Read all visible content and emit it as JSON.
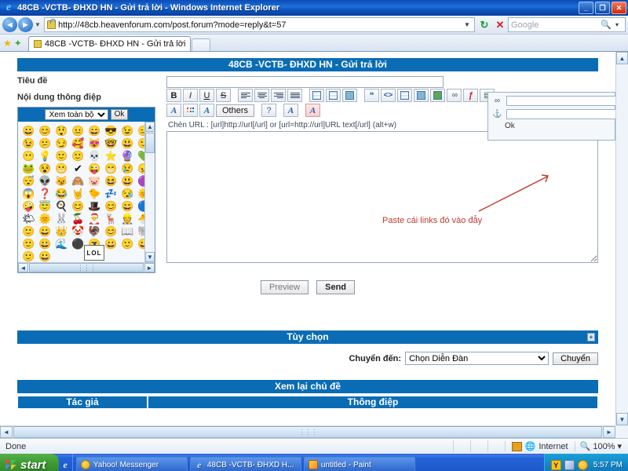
{
  "window": {
    "title": "48CB -VCTB- ĐHXD HN - Gửi trả lời - Windows Internet Explorer",
    "minimize_label": "_",
    "restore_label": "❐",
    "close_label": "✕"
  },
  "browser": {
    "back_label": "◄",
    "forward_label": "►",
    "nav_caret": "▼",
    "url": "http://48cb.heavenforum.com/post.forum?mode=reply&t=57",
    "url_caret": "▼",
    "refresh_label": "↻",
    "stop_label": "✕",
    "search_placeholder": "Google",
    "search_value": "",
    "search_icon": "🔍",
    "search_caret": "▾",
    "tab_title": "48CB -VCTB- ĐHXD HN - Gửi trả lời",
    "favorites_star": "★",
    "add_favorites_star": "✦"
  },
  "forum": {
    "header_title": "48CB -VCTB- ĐHXD HN - Gửi trả lời",
    "subject_label": "Tiêu đề",
    "subject_value": "",
    "message_label": "Nội dung thông điệp",
    "message_value": "",
    "url_hint": "Chèn URL : [url]http://url[/url] or [url=http://url]URL text[/url] (alt+w)",
    "preview_label": "Preview",
    "send_label": "Send",
    "options_title": "Tùy chọn",
    "options_toggle": "+",
    "jump_label": "Chuyển đến:",
    "jump_selected": "Chọn Diễn Đàn",
    "jump_button": "Chuyển",
    "review_title": "Xem lại chủ đề",
    "review_columns": [
      "Tác giả",
      "Thông điệp"
    ]
  },
  "toolbar": {
    "row1": [
      {
        "name": "bold-button",
        "label": "B",
        "cls": "b"
      },
      {
        "name": "italic-button",
        "label": "I",
        "cls": "i"
      },
      {
        "name": "underline-button",
        "label": "U",
        "cls": "u"
      },
      {
        "name": "strikethrough-button",
        "label": "S",
        "cls": "s"
      },
      {
        "name": "separator",
        "label": "",
        "cls": "sep"
      },
      {
        "name": "align-left-button",
        "label": "",
        "cls": "al bars"
      },
      {
        "name": "align-center-button",
        "label": "",
        "cls": "ac bars"
      },
      {
        "name": "align-right-button",
        "label": "",
        "cls": "ar bars"
      },
      {
        "name": "align-justify-button",
        "label": "",
        "cls": "aj bars"
      },
      {
        "name": "separator",
        "label": "",
        "cls": "sep"
      },
      {
        "name": "bullet-list-button",
        "label": "",
        "cls": "listb"
      },
      {
        "name": "numbered-list-button",
        "label": "",
        "cls": "listn"
      },
      {
        "name": "indent-button",
        "label": "",
        "cls": "indent"
      },
      {
        "name": "separator",
        "label": "",
        "cls": "sep"
      },
      {
        "name": "quote-button",
        "label": "❝",
        "cls": "quote"
      },
      {
        "name": "code-button",
        "label": "<>",
        "cls": "code"
      },
      {
        "name": "table-button",
        "label": "",
        "cls": "table"
      },
      {
        "name": "save-draft-button",
        "label": "",
        "cls": "save"
      },
      {
        "name": "image-button",
        "label": "",
        "cls": "image"
      },
      {
        "name": "link-button",
        "label": "∞",
        "cls": "link"
      },
      {
        "name": "flash-button",
        "label": "ƒ",
        "cls": "flash"
      },
      {
        "name": "video-button",
        "label": "▤",
        "cls": "film"
      }
    ],
    "row2": [
      {
        "name": "font-color-button",
        "label": "A",
        "cls": "fontcolor"
      },
      {
        "name": "highlight-color-button",
        "label": "",
        "cls": "palette"
      },
      {
        "name": "font-face-button",
        "label": "A",
        "cls": "fontface"
      },
      {
        "name": "others-button",
        "label": "Others",
        "cls": "wide"
      },
      {
        "name": "separator",
        "label": "",
        "cls": "sep"
      },
      {
        "name": "help-button",
        "label": "?",
        "cls": "globe"
      },
      {
        "name": "separator",
        "label": "",
        "cls": "sep"
      },
      {
        "name": "font-size-button",
        "label": "A",
        "cls": "fontsize"
      },
      {
        "name": "separator",
        "label": "",
        "cls": "sep"
      },
      {
        "name": "remove-format-button",
        "label": "A",
        "cls": "hl removefmt"
      }
    ]
  },
  "url_popup": {
    "link_icon": "∞",
    "anchor_icon": "⚓",
    "url_value": "",
    "text_value": "",
    "ok_label": "Ok"
  },
  "annotation": {
    "text": "Paste cái links đó vào đẫy",
    "color": "#c0392b"
  },
  "smileys": {
    "select_value": "Xem toàn bộ",
    "ok_label": "Ok",
    "lol_label": "LOL",
    "glyphs": [
      "😀",
      "😊",
      "😲",
      "😐",
      "😄",
      "😎",
      "😉",
      "😑",
      "😉",
      "😕",
      "😏",
      "🥰",
      "😻",
      "🤓",
      "😃",
      "🙂",
      "😶",
      "💡",
      "🙂",
      "🙂",
      "💀",
      "⭐",
      "🔮",
      "💚",
      "🐸",
      "😵",
      "😬",
      "✔",
      "😜",
      "😁",
      "😢",
      "😠",
      "😴",
      "👽",
      "😼",
      "🙈",
      "🐷",
      "😆",
      "😃",
      "🟣",
      "😱",
      "❓",
      "😂",
      "🤘",
      "🐤",
      "💤",
      "😪",
      "🌞",
      "🤪",
      "😇",
      "🍳",
      "😊",
      "🎩",
      "😊",
      "😄",
      "🔵",
      "🌤",
      "🌞",
      "🐰",
      "🍒",
      "🎅",
      "🦌",
      "👷",
      "🐣",
      "🙂",
      "😀",
      "👑",
      "🤡",
      "🦃",
      "😊",
      "📖",
      "🐘",
      "🙂",
      "😀",
      "🌊",
      "⚫",
      "🙂",
      "😀",
      "🙂",
      "😀",
      "🙂",
      "😀"
    ],
    "scroll_left": "◄",
    "scroll_right": "►",
    "scroll_up": "▲",
    "scroll_down": "▼",
    "grip": "⋮⋮⋮"
  },
  "scrollbars": {
    "up": "▲",
    "down": "▼",
    "left": "◄",
    "right": "►",
    "grip": "⋮⋮⋮"
  },
  "statusbar": {
    "status": "Done",
    "zone": "Internet",
    "zone_icon": "🌐",
    "zoom": "100%",
    "zoom_icon": "🔍",
    "zoom_caret": "▾"
  },
  "taskbar": {
    "start_label": "start",
    "quicklaunch": [
      "e"
    ],
    "tasks": [
      {
        "name": "taskbar-item-yahoo-messenger",
        "label": "Yahoo! Messenger",
        "icon": "yahoo"
      },
      {
        "name": "taskbar-item-internet-explorer",
        "label": "48CB -VCTB- ĐHXD H...",
        "icon": "ie"
      },
      {
        "name": "taskbar-item-paint",
        "label": "untitled - Paint",
        "icon": "paint"
      }
    ],
    "tray_y": "Y",
    "clock": "5:57 PM"
  }
}
